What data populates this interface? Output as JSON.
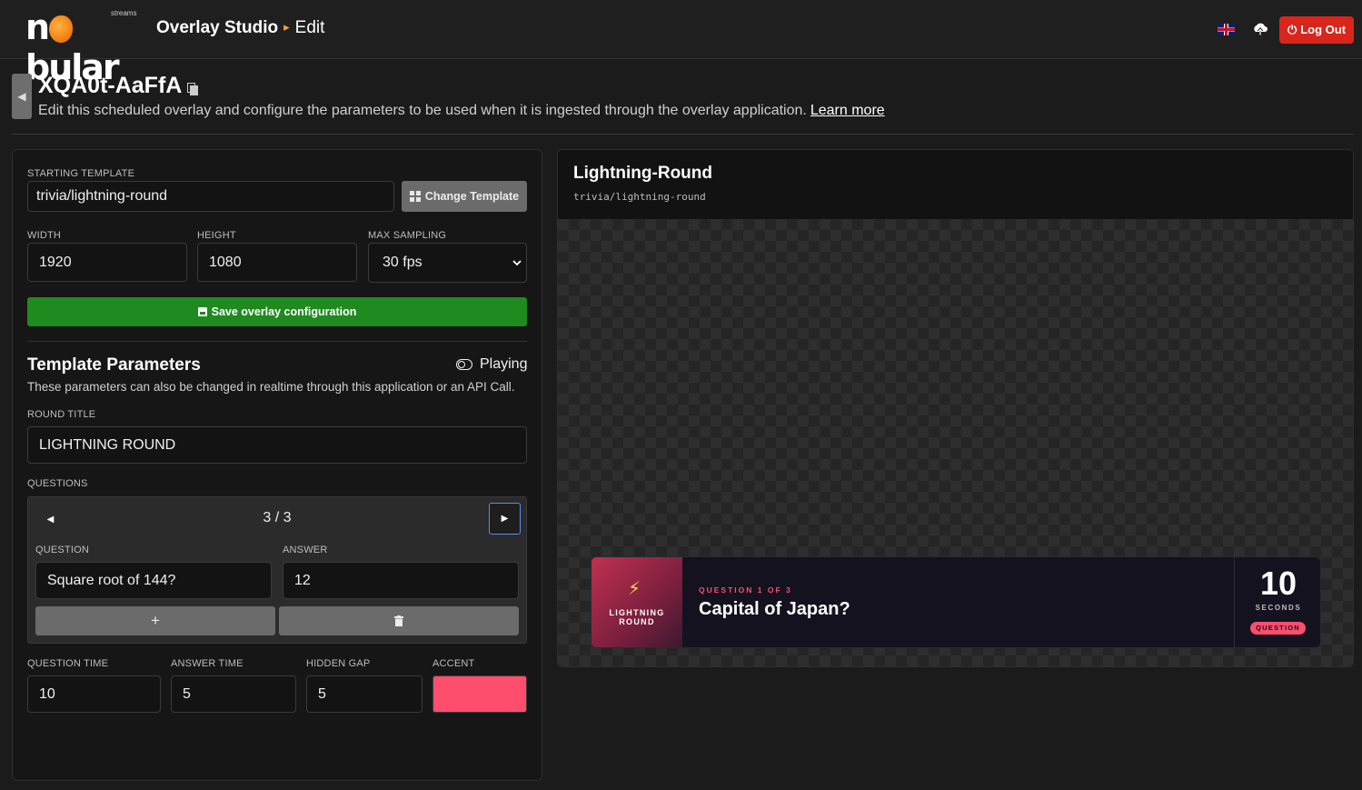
{
  "nav": {
    "logo_text_left": "n",
    "logo_text_right": "bular",
    "logo_sub": "streams",
    "app_title": "Overlay Studio",
    "breadcrumb_separator": "▸",
    "breadcrumb_current": "Edit",
    "logout_label": "Log Out",
    "icons": [
      "uk-flag-icon",
      "upload-icon",
      "power-icon"
    ],
    "logout_color": "#d9261c"
  },
  "header": {
    "overlay_id": "XQA0t-AaFfA",
    "description": "Edit this scheduled overlay and configure the parameters to be used when it is ingested through the overlay application.",
    "learn_more": "Learn more"
  },
  "config": {
    "starting_template_label": "STARTING TEMPLATE",
    "starting_template_value": "trivia/lightning-round",
    "change_template_label": "Change Template",
    "width_label": "WIDTH",
    "width_value": "1920",
    "height_label": "HEIGHT",
    "height_value": "1080",
    "max_sampling_label": "MAX SAMPLING",
    "max_sampling_value": "30 fps",
    "save_label": "Save overlay configuration",
    "save_color": "#1f8a1f"
  },
  "params": {
    "title": "Template Parameters",
    "playing_label": "Playing",
    "description": "These parameters can also be changed in realtime through this application or an API Call.",
    "round_title_label": "ROUND TITLE",
    "round_title_value": "LIGHTNING ROUND",
    "questions_label": "QUESTIONS",
    "pager": "3 / 3",
    "question_label": "QUESTION",
    "question_value": "Square root of 144?",
    "answer_label": "ANSWER",
    "answer_value": "12",
    "add_label": "+",
    "question_time_label": "QUESTION TIME",
    "question_time_value": "10",
    "answer_time_label": "ANSWER TIME",
    "answer_time_value": "5",
    "hidden_gap_label": "HIDDEN GAP",
    "hidden_gap_value": "5",
    "accent_label": "ACCENT",
    "accent_color": "#ff4d6d"
  },
  "preview": {
    "title": "Lightning-Round",
    "path": "trivia/lightning-round",
    "badge_line1": "LIGHTNING",
    "badge_line2": "ROUND",
    "eyebrow": "QUESTION 1 OF 3",
    "question": "Capital of Japan?",
    "timer_value": "10",
    "timer_unit": "SECONDS",
    "phase": "QUESTION"
  }
}
